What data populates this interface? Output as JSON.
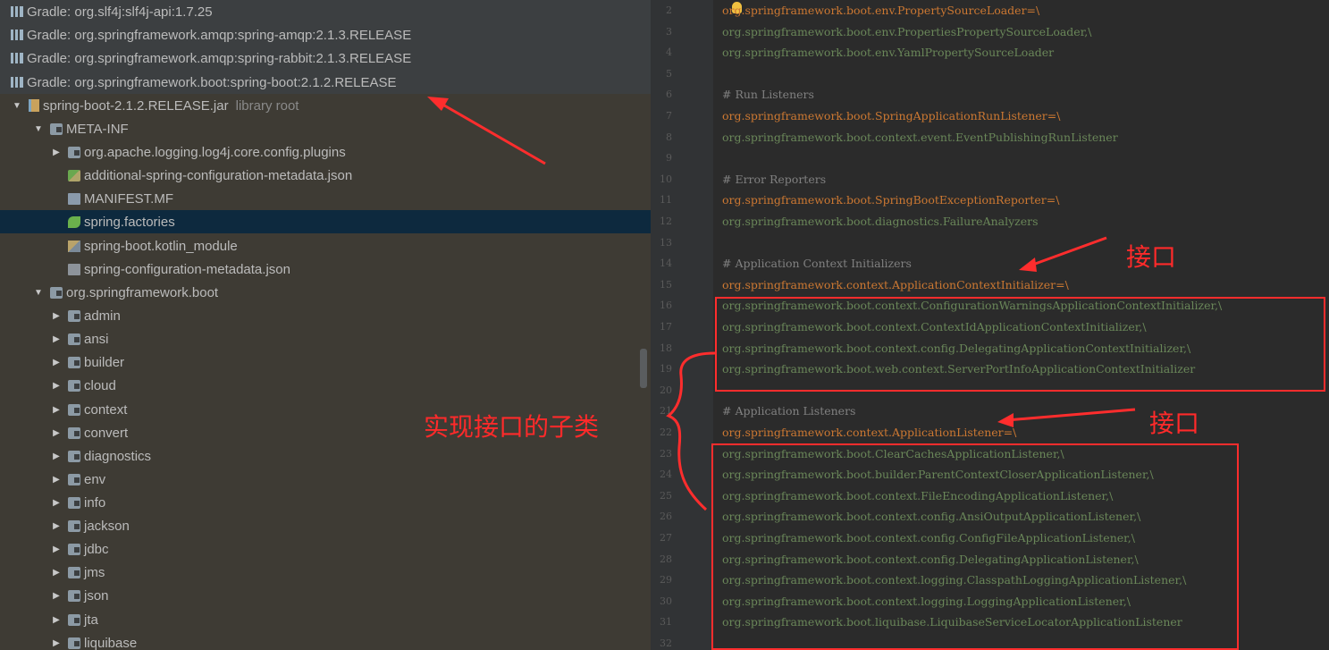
{
  "project_tree": {
    "rows": [
      {
        "indent": 0,
        "arrow": "",
        "icon": "gradle-library-icon",
        "label": "Gradle: org.slf4j:slf4j-api:1.7.25",
        "muted": ""
      },
      {
        "indent": 0,
        "arrow": "",
        "icon": "gradle-library-icon",
        "label": "Gradle: org.springframework.amqp:spring-amqp:2.1.3.RELEASE",
        "muted": ""
      },
      {
        "indent": 0,
        "arrow": "",
        "icon": "gradle-library-icon",
        "label": "Gradle: org.springframework.amqp:spring-rabbit:2.1.3.RELEASE",
        "muted": ""
      },
      {
        "indent": 0,
        "arrow": "",
        "icon": "gradle-library-icon",
        "label": "Gradle: org.springframework.boot:spring-boot:2.1.2.RELEASE",
        "muted": ""
      },
      {
        "indent": 1,
        "arrow": "▼",
        "icon": "jar-icon",
        "label": "spring-boot-2.1.2.RELEASE.jar",
        "muted": "library root"
      },
      {
        "indent": 2,
        "arrow": "▼",
        "icon": "folder-icon",
        "label": "META-INF",
        "muted": ""
      },
      {
        "indent": 3,
        "arrow": "▶",
        "icon": "folder-icon",
        "label": "org.apache.logging.log4j.core.config.plugins",
        "muted": ""
      },
      {
        "indent": 3,
        "arrow": "",
        "icon": "json-metadata-icon",
        "label": "additional-spring-configuration-metadata.json",
        "muted": ""
      },
      {
        "indent": 3,
        "arrow": "",
        "icon": "manifest-icon",
        "label": "MANIFEST.MF",
        "muted": ""
      },
      {
        "indent": 3,
        "arrow": "",
        "icon": "spring-leaf-icon",
        "label": "spring.factories",
        "muted": "",
        "selected": true
      },
      {
        "indent": 3,
        "arrow": "",
        "icon": "kotlin-module-icon",
        "label": "spring-boot.kotlin_module",
        "muted": ""
      },
      {
        "indent": 3,
        "arrow": "",
        "icon": "config-json-icon",
        "label": "spring-configuration-metadata.json",
        "muted": ""
      },
      {
        "indent": 2,
        "arrow": "▼",
        "icon": "folder-icon",
        "label": "org.springframework.boot",
        "muted": ""
      },
      {
        "indent": 3,
        "arrow": "▶",
        "icon": "folder-icon",
        "label": "admin",
        "muted": ""
      },
      {
        "indent": 3,
        "arrow": "▶",
        "icon": "folder-icon",
        "label": "ansi",
        "muted": ""
      },
      {
        "indent": 3,
        "arrow": "▶",
        "icon": "folder-icon",
        "label": "builder",
        "muted": ""
      },
      {
        "indent": 3,
        "arrow": "▶",
        "icon": "folder-icon",
        "label": "cloud",
        "muted": ""
      },
      {
        "indent": 3,
        "arrow": "▶",
        "icon": "folder-icon",
        "label": "context",
        "muted": ""
      },
      {
        "indent": 3,
        "arrow": "▶",
        "icon": "folder-icon",
        "label": "convert",
        "muted": ""
      },
      {
        "indent": 3,
        "arrow": "▶",
        "icon": "folder-icon",
        "label": "diagnostics",
        "muted": ""
      },
      {
        "indent": 3,
        "arrow": "▶",
        "icon": "folder-icon",
        "label": "env",
        "muted": ""
      },
      {
        "indent": 3,
        "arrow": "▶",
        "icon": "folder-icon",
        "label": "info",
        "muted": ""
      },
      {
        "indent": 3,
        "arrow": "▶",
        "icon": "folder-icon",
        "label": "jackson",
        "muted": ""
      },
      {
        "indent": 3,
        "arrow": "▶",
        "icon": "folder-icon",
        "label": "jdbc",
        "muted": ""
      },
      {
        "indent": 3,
        "arrow": "▶",
        "icon": "folder-icon",
        "label": "jms",
        "muted": ""
      },
      {
        "indent": 3,
        "arrow": "▶",
        "icon": "folder-icon",
        "label": "json",
        "muted": ""
      },
      {
        "indent": 3,
        "arrow": "▶",
        "icon": "folder-icon",
        "label": "jta",
        "muted": ""
      },
      {
        "indent": 3,
        "arrow": "▶",
        "icon": "folder-icon",
        "label": "liquibase",
        "muted": ""
      }
    ]
  },
  "editor": {
    "lines": [
      {
        "n": "2",
        "kind": "key",
        "text": "org.springframework.boot.env.PropertySourceLoader=\\"
      },
      {
        "n": "3",
        "kind": "val",
        "text": "org.springframework.boot.env.PropertiesPropertySourceLoader,\\"
      },
      {
        "n": "4",
        "kind": "val",
        "text": "org.springframework.boot.env.YamlPropertySourceLoader"
      },
      {
        "n": "5",
        "kind": "blank",
        "text": ""
      },
      {
        "n": "6",
        "kind": "com",
        "text": "# Run Listeners"
      },
      {
        "n": "7",
        "kind": "key",
        "text": "org.springframework.boot.SpringApplicationRunListener=\\"
      },
      {
        "n": "8",
        "kind": "val",
        "text": "org.springframework.boot.context.event.EventPublishingRunListener"
      },
      {
        "n": "9",
        "kind": "blank",
        "text": ""
      },
      {
        "n": "10",
        "kind": "com",
        "text": "# Error Reporters"
      },
      {
        "n": "11",
        "kind": "key",
        "text": "org.springframework.boot.SpringBootExceptionReporter=\\"
      },
      {
        "n": "12",
        "kind": "val",
        "text": "org.springframework.boot.diagnostics.FailureAnalyzers"
      },
      {
        "n": "13",
        "kind": "blank",
        "text": ""
      },
      {
        "n": "14",
        "kind": "com",
        "text": "# Application Context Initializers"
      },
      {
        "n": "15",
        "kind": "key",
        "text": "org.springframework.context.ApplicationContextInitializer=\\"
      },
      {
        "n": "16",
        "kind": "val",
        "text": "org.springframework.boot.context.ConfigurationWarningsApplicationContextInitializer,\\"
      },
      {
        "n": "17",
        "kind": "val",
        "text": "org.springframework.boot.context.ContextIdApplicationContextInitializer,\\"
      },
      {
        "n": "18",
        "kind": "val",
        "text": "org.springframework.boot.context.config.DelegatingApplicationContextInitializer,\\"
      },
      {
        "n": "19",
        "kind": "val",
        "text": "org.springframework.boot.web.context.ServerPortInfoApplicationContextInitializer"
      },
      {
        "n": "20",
        "kind": "blank",
        "text": ""
      },
      {
        "n": "21",
        "kind": "com",
        "text": "# Application Listeners"
      },
      {
        "n": "22",
        "kind": "key",
        "text": "org.springframework.context.ApplicationListener=\\"
      },
      {
        "n": "23",
        "kind": "val",
        "text": "org.springframework.boot.ClearCachesApplicationListener,\\"
      },
      {
        "n": "24",
        "kind": "val",
        "text": "org.springframework.boot.builder.ParentContextCloserApplicationListener,\\"
      },
      {
        "n": "25",
        "kind": "val",
        "text": "org.springframework.boot.context.FileEncodingApplicationListener,\\"
      },
      {
        "n": "26",
        "kind": "val",
        "text": "org.springframework.boot.context.config.AnsiOutputApplicationListener,\\"
      },
      {
        "n": "27",
        "kind": "val",
        "text": "org.springframework.boot.context.config.ConfigFileApplicationListener,\\"
      },
      {
        "n": "28",
        "kind": "val",
        "text": "org.springframework.boot.context.config.DelegatingApplicationListener,\\"
      },
      {
        "n": "29",
        "kind": "val",
        "text": "org.springframework.boot.context.logging.ClasspathLoggingApplicationListener,\\"
      },
      {
        "n": "30",
        "kind": "val",
        "text": "org.springframework.boot.context.logging.LoggingApplicationListener,\\"
      },
      {
        "n": "31",
        "kind": "val",
        "text": "org.springframework.boot.liquibase.LiquibaseServiceLocatorApplicationListener"
      },
      {
        "n": "32",
        "kind": "blank",
        "text": ""
      }
    ]
  },
  "annotations": {
    "interface_label_1": "接口",
    "interface_label_2": "接口",
    "subclass_label": "实现接口的子类",
    "color": "#ff2d2d"
  },
  "colors": {
    "tree_bg": "#3c3f41",
    "selected_row": "#0d293e",
    "editor_bg": "#2b2b2b",
    "key": "#cc7832",
    "value": "#6a8759",
    "comment": "#808080"
  }
}
